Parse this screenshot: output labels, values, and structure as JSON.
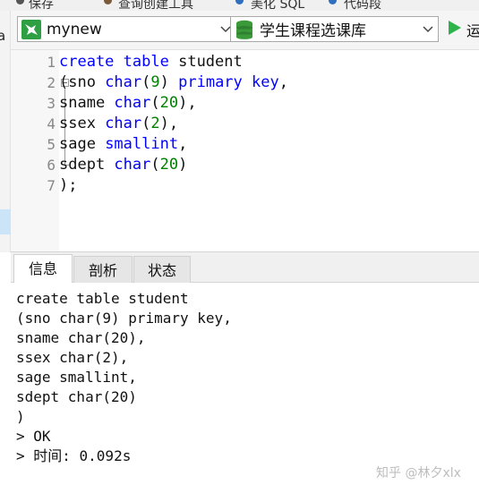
{
  "toolbar_fragments": [
    "保存",
    "查询创建工具",
    "美化 SQL",
    "代码段"
  ],
  "sidebar": {
    "cut_label": "a"
  },
  "connection": {
    "name": "mynew",
    "icon": "connection-icon"
  },
  "database": {
    "name": "学生课程选课库",
    "icon": "database-icon"
  },
  "run": {
    "label": "运",
    "icon": "run-icon"
  },
  "editor": {
    "line_numbers": [
      "1",
      "2",
      "3",
      "4",
      "5",
      "6",
      "7"
    ],
    "lines": [
      [
        {
          "t": "create",
          "c": "kw"
        },
        {
          "t": " ",
          "c": "id"
        },
        {
          "t": "table",
          "c": "kw"
        },
        {
          "t": " student",
          "c": "id"
        }
      ],
      [
        {
          "t": "(sno ",
          "c": "id"
        },
        {
          "t": "char",
          "c": "kw"
        },
        {
          "t": "(",
          "c": "id"
        },
        {
          "t": "9",
          "c": "num"
        },
        {
          "t": ") ",
          "c": "id"
        },
        {
          "t": "primary",
          "c": "kw"
        },
        {
          "t": " ",
          "c": "id"
        },
        {
          "t": "key",
          "c": "kw"
        },
        {
          "t": ",",
          "c": "id"
        }
      ],
      [
        {
          "t": "sname ",
          "c": "id"
        },
        {
          "t": "char",
          "c": "kw"
        },
        {
          "t": "(",
          "c": "id"
        },
        {
          "t": "20",
          "c": "num"
        },
        {
          "t": "),",
          "c": "id"
        }
      ],
      [
        {
          "t": "ssex ",
          "c": "id"
        },
        {
          "t": "char",
          "c": "kw"
        },
        {
          "t": "(",
          "c": "id"
        },
        {
          "t": "2",
          "c": "num"
        },
        {
          "t": "),",
          "c": "id"
        }
      ],
      [
        {
          "t": "sage ",
          "c": "id"
        },
        {
          "t": "smallint",
          "c": "kw"
        },
        {
          "t": ",",
          "c": "id"
        }
      ],
      [
        {
          "t": "sdept ",
          "c": "id"
        },
        {
          "t": "char",
          "c": "kw"
        },
        {
          "t": "(",
          "c": "id"
        },
        {
          "t": "20",
          "c": "num"
        },
        {
          "t": ")",
          "c": "id"
        }
      ],
      [
        {
          "t": ");",
          "c": "id"
        }
      ]
    ]
  },
  "tabs": [
    {
      "label": "信息",
      "active": true
    },
    {
      "label": "剖析",
      "active": false
    },
    {
      "label": "状态",
      "active": false
    }
  ],
  "output": {
    "lines": [
      "create table student",
      "(sno char(9) primary key,",
      "sname char(20),",
      "ssex char(2),",
      "sage smallint,",
      "sdept char(20)",
      ")",
      "> OK",
      "> 时间: 0.092s"
    ]
  },
  "watermark": "知乎 @林夕xlx",
  "colors": {
    "keyword": "#0000ff",
    "number": "#008000",
    "run_green": "#2db34a",
    "db_green": "#3a9a3a"
  }
}
